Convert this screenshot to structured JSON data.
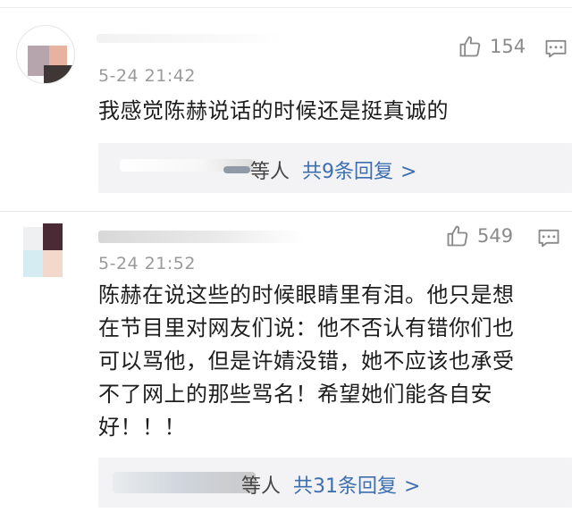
{
  "colors": {
    "link": "#3c6fb0",
    "meta": "#9a9a9a",
    "text": "#1d1d1d",
    "reply_box_bg": "#f3f3f5"
  },
  "comments": [
    {
      "timestamp": "5-24 21:42",
      "like_icon": "thumbs-up-icon",
      "likes": "154",
      "reply_icon": "comment-bubble-icon",
      "text": [
        "我感觉陈赫说话的时候还是挺真诚的"
      ],
      "replies": {
        "by_text": "等人",
        "count_text": "共9条回复",
        "chevron": ">"
      }
    },
    {
      "timestamp": "5-24 21:52",
      "like_icon": "thumbs-up-icon",
      "likes": "549",
      "reply_icon": "comment-bubble-icon",
      "text": [
        "陈赫在说这些的时候眼睛里有泪。他只是想",
        "在节目里对网友们说：他不否认有错你们也",
        "可以骂他，但是许婧没错，她不应该也承受",
        "不了网上的那些骂名！希望她们能各自安",
        "好！！！"
      ],
      "replies": {
        "by_text": "等人",
        "count_text": "共31条回复",
        "chevron": ">"
      }
    }
  ]
}
